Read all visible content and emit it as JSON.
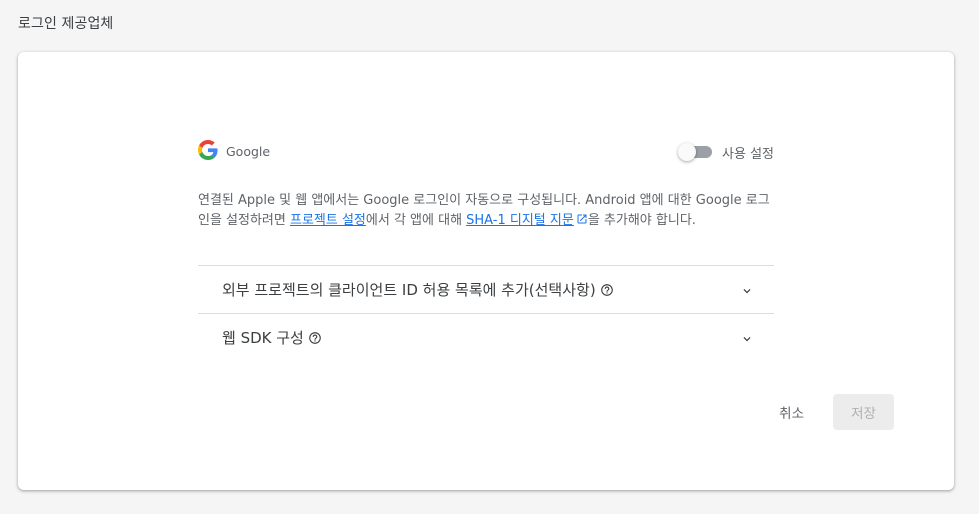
{
  "page": {
    "title": "로그인 제공업체"
  },
  "provider": {
    "name": "Google",
    "icon": "google-g-icon",
    "toggle_label": "사용 설정",
    "enabled": false
  },
  "description": {
    "part1": "연결된 Apple 및 웹 앱에서는 Google 로그인이 자동으로 구성됩니다. Android 앱에 대한 Google 로그인을 설정하려면 ",
    "link1": "프로젝트 설정",
    "part2": "에서 각 앱에 대해 ",
    "link2": "SHA-1 디지털 지문",
    "part3": "을 추가해야 합니다."
  },
  "accordion": [
    {
      "title": "외부 프로젝트의 클라이언트 ID 허용 목록에 추가(선택사항)"
    },
    {
      "title": "웹 SDK 구성"
    }
  ],
  "actions": {
    "cancel_label": "취소",
    "save_label": "저장"
  },
  "colors": {
    "link": "#1a73e8",
    "text_secondary": "#5f6368",
    "toggle_track_off": "#9aa0a6"
  }
}
